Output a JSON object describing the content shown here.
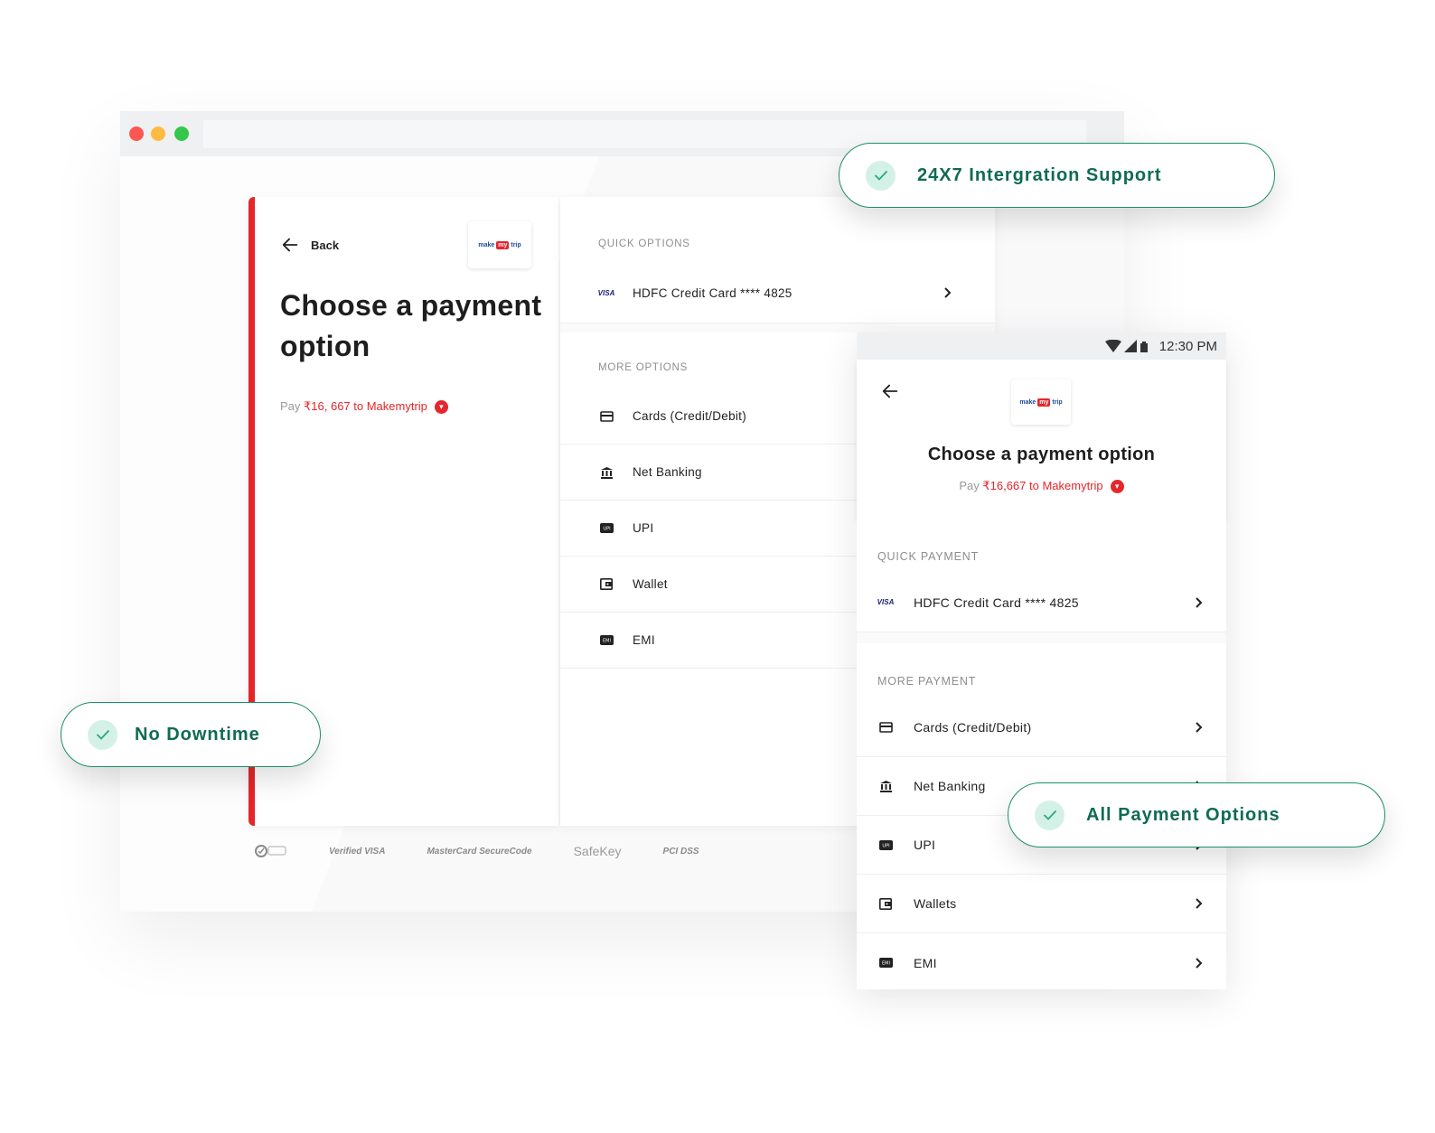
{
  "desktop": {
    "back_label": "Back",
    "title": "Choose a payment option",
    "pay_prefix": "Pay ",
    "pay_amount": "₹16, 667 to Makemytrip",
    "logo": {
      "part1": "make",
      "part2": "my",
      "part3": "trip"
    },
    "quick_options_label": "QUICK OPTIONS",
    "quick_card": "HDFC Credit Card **** 4825",
    "more_options_label": "MORE OPTIONS",
    "options": [
      {
        "label": "Cards (Credit/Debit)",
        "icon": "card-icon"
      },
      {
        "label": "Net Banking",
        "icon": "bank-icon"
      },
      {
        "label": "UPI",
        "icon": "upi-icon"
      },
      {
        "label": "Wallet",
        "icon": "wallet-icon"
      },
      {
        "label": "EMI",
        "icon": "emi-icon"
      }
    ],
    "trust_badges": [
      "Verified VISA",
      "MasterCard SecureCode",
      "SafeKey",
      "PCI DSS"
    ]
  },
  "mobile": {
    "status_time": "12:30 PM",
    "title": "Choose a payment option",
    "pay_prefix": "Pay ",
    "pay_amount": "₹16,667 to Makemytrip",
    "quick_payment_label": "QUICK PAYMENT",
    "quick_card": "HDFC Credit Card **** 4825",
    "more_payment_label": "MORE PAYMENT",
    "options": [
      {
        "label": "Cards (Credit/Debit)",
        "icon": "card-icon"
      },
      {
        "label": "Net Banking",
        "icon": "bank-icon"
      },
      {
        "label": "UPI",
        "icon": "upi-icon"
      },
      {
        "label": "Wallets",
        "icon": "wallet-icon"
      },
      {
        "label": "EMI",
        "icon": "emi-icon"
      }
    ]
  },
  "features": {
    "support": "24X7 Intergration Support",
    "downtime": "No Downtime",
    "all_options": "All Payment Options"
  },
  "colors": {
    "brand_red": "#e5262b",
    "feature_green": "#0f6b52",
    "pill_border": "#1b8e6a",
    "check_bg": "#d4f1e7"
  }
}
